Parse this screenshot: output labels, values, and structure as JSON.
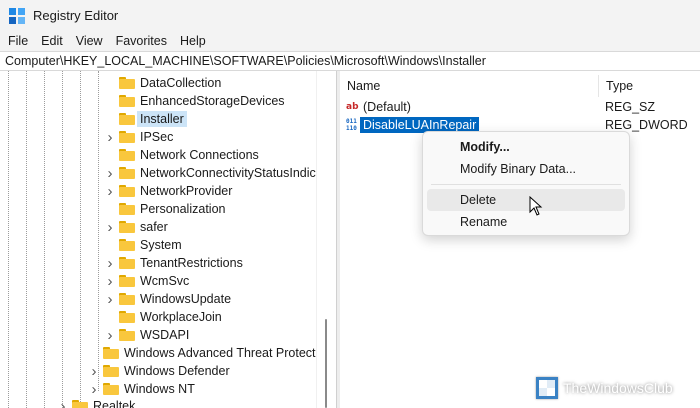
{
  "window": {
    "title": "Registry Editor",
    "app_icon": "registry-editor-icon"
  },
  "menu": [
    "File",
    "Edit",
    "View",
    "Favorites",
    "Help"
  ],
  "address": "Computer\\HKEY_LOCAL_MACHINE\\SOFTWARE\\Policies\\Microsoft\\Windows\\Installer",
  "tree": {
    "items": [
      {
        "label": "DataCollection",
        "expandable": false,
        "selected": false
      },
      {
        "label": "EnhancedStorageDevices",
        "expandable": false,
        "selected": false
      },
      {
        "label": "Installer",
        "expandable": false,
        "selected": true
      },
      {
        "label": "IPSec",
        "expandable": true,
        "selected": false
      },
      {
        "label": "Network Connections",
        "expandable": false,
        "selected": false
      },
      {
        "label": "NetworkConnectivityStatusIndicator",
        "expandable": true,
        "selected": false
      },
      {
        "label": "NetworkProvider",
        "expandable": true,
        "selected": false
      },
      {
        "label": "Personalization",
        "expandable": false,
        "selected": false
      },
      {
        "label": "safer",
        "expandable": true,
        "selected": false
      },
      {
        "label": "System",
        "expandable": false,
        "selected": false
      },
      {
        "label": "TenantRestrictions",
        "expandable": true,
        "selected": false
      },
      {
        "label": "WcmSvc",
        "expandable": true,
        "selected": false
      },
      {
        "label": "WindowsUpdate",
        "expandable": true,
        "selected": false
      },
      {
        "label": "WorkplaceJoin",
        "expandable": false,
        "selected": false
      },
      {
        "label": "WSDAPI",
        "expandable": true,
        "selected": false
      },
      {
        "label": "Windows Advanced Threat Protection",
        "expandable": false,
        "selected": false
      },
      {
        "label": "Windows Defender",
        "expandable": true,
        "selected": false
      },
      {
        "label": "Windows NT",
        "expandable": true,
        "selected": false
      },
      {
        "label": "Realtek",
        "expandable": true,
        "selected": false
      }
    ]
  },
  "values_pane": {
    "columns": {
      "name": "Name",
      "type": "Type"
    },
    "rows": [
      {
        "name": "(Default)",
        "type": "REG_SZ",
        "icon": "string-value-icon",
        "icon_text": "ab"
      },
      {
        "name": "DisableLUAInRepair",
        "type": "REG_DWORD",
        "icon": "binary-value-icon",
        "icon_text": [
          "011",
          "110"
        ]
      }
    ]
  },
  "context_menu": {
    "items": [
      {
        "label": "Modify...",
        "bold": true
      },
      {
        "label": "Modify Binary Data..."
      },
      {
        "label": "Delete",
        "hover": true
      },
      {
        "label": "Rename"
      }
    ]
  },
  "watermark": {
    "text": "TheWindowsClub"
  },
  "colors": {
    "selection": "#0067c0",
    "tree_selection": "#cce4f7",
    "folder": "#f9c73d",
    "accent": "#1e88e5"
  }
}
